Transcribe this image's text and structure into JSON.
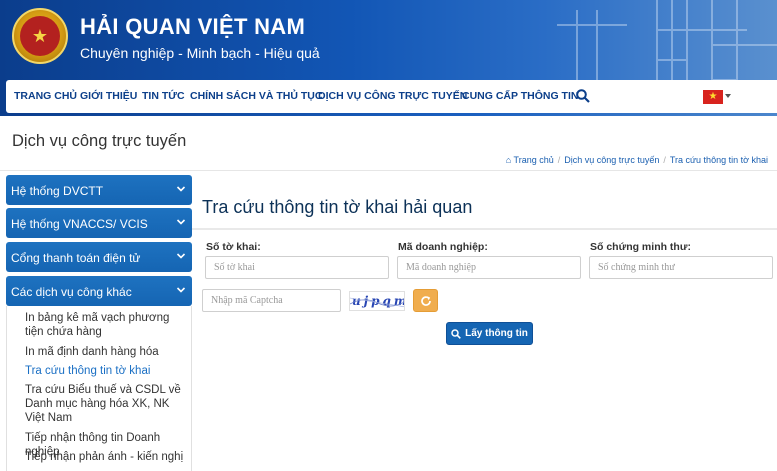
{
  "header": {
    "title": "HẢI QUAN VIỆT NAM",
    "subtitle": "Chuyên nghiệp - Minh bạch - Hiệu quả",
    "logo_icon": "vietnam-customs-logo"
  },
  "nav": {
    "items": [
      {
        "label": "TRANG CHỦ"
      },
      {
        "label": "GIỚI THIỆU"
      },
      {
        "label": "TIN TỨC"
      },
      {
        "label": "CHÍNH SÁCH VÀ THỦ TỤC"
      },
      {
        "label": "DỊCH VỤ CÔNG TRỰC TUYẾN"
      },
      {
        "label": "CUNG CẤP THÔNG TIN"
      }
    ],
    "search_icon": "search-icon",
    "language_flag": "vietnam-flag-icon"
  },
  "page": {
    "title": "Dịch vụ công trực tuyến",
    "breadcrumb": [
      "Trang chủ",
      "Dịch vụ công trực tuyến",
      "Tra cứu thông tin tờ khai"
    ]
  },
  "sidebar": {
    "sections": [
      {
        "label": "Hệ thống DVCTT"
      },
      {
        "label": "Hệ thống VNACCS/ VCIS"
      },
      {
        "label": "Cổng thanh toán điện tử"
      },
      {
        "label": "Các dịch vụ công khác"
      }
    ],
    "sub_items": [
      {
        "label": "In bảng kê mã vạch phương tiện chứa hàng",
        "active": false
      },
      {
        "label": "In mã định danh hàng hóa",
        "active": false
      },
      {
        "label": "Tra cứu thông tin tờ khai",
        "active": true
      },
      {
        "label": "Tra cứu Biểu thuế và CSDL về Danh mục hàng hóa XK, NK Việt Nam",
        "active": false
      },
      {
        "label": "Tiếp nhận thông tin Doanh nghiệp",
        "active": false
      },
      {
        "label": "Tiếp nhận phản ánh - kiến nghị",
        "active": false
      }
    ]
  },
  "form": {
    "title": "Tra cứu thông tin tờ khai hải quan",
    "fields": [
      {
        "label": "Số tờ khai:",
        "placeholder": "Số tờ khai",
        "value": ""
      },
      {
        "label": "Mã doanh nghiệp:",
        "placeholder": "Mã doanh nghiệp",
        "value": ""
      },
      {
        "label": "Số chứng minh thư:",
        "placeholder": "Số chứng minh thư",
        "value": ""
      }
    ],
    "captcha": {
      "placeholder": "Nhập mã Captcha",
      "value": "",
      "image_text": "ujpqm"
    },
    "refresh_icon": "refresh-icon",
    "submit_label": "Lấy thông tin"
  },
  "colors": {
    "header_blue": "#0b3d8c",
    "nav_text": "#0c3f8a",
    "sidebar_blue": "#1565b3",
    "active_link": "#1a6fc4",
    "refresh_orange": "#f0ad4e"
  }
}
